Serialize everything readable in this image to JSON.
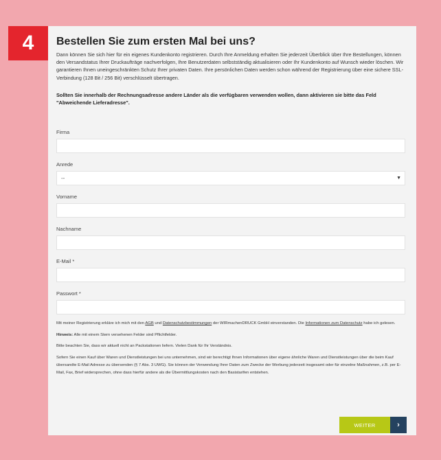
{
  "step": {
    "number": "4"
  },
  "header": {
    "title": "Bestellen Sie zum ersten Mal bei uns?",
    "intro": "Dann können Sie sich hier für ein eigenes Kundenkonto registrieren. Durch Ihre Anmeldung erhalten Sie jederzeit Überblick über Ihre Bestellungen, können den Versandstatus Ihrer Druckaufträge nachverfolgen, Ihre Benutzerdaten selbstständig aktualisieren oder Ihr Kundenkonto auf Wunsch wieder löschen. Wir garantieren Ihnen uneingeschränkten Schutz Ihrer privaten Daten. Ihre persönlichen Daten werden schon während der Registrierung über eine sichere SSL-Verbindung (128 Bit / 256 Bit) verschlüsselt übertragen.",
    "notice": "Sollten Sie innerhalb der Rechnungsadresse andere Länder als die verfügbaren verwenden wollen, dann aktivieren sie bitte das Feld \"Abweichende Lieferadresse\"."
  },
  "form": {
    "firma": {
      "label": "Firma",
      "value": ""
    },
    "anrede": {
      "label": "Anrede",
      "selected": "--"
    },
    "vorname": {
      "label": "Vorname",
      "value": ""
    },
    "nachname": {
      "label": "Nachname",
      "value": ""
    },
    "email": {
      "label": "E-Mail *",
      "value": ""
    },
    "passwort": {
      "label": "Passwort *",
      "value": ""
    }
  },
  "legal": {
    "consent_prefix": "Mit meiner Registrierung erkläre ich mich mit den ",
    "agb_link": "AGB",
    "consent_and": " und ",
    "privacy_link": "Datenschutzbestimmungen",
    "consent_mid": " der WIRmachenDRUCK GmbH einverstanden. Die ",
    "info_link": "Informationen zum Datenschutz",
    "consent_suffix": " habe ich gelesen.",
    "hint_label": "Hinweis:",
    "hint_text": " Alle mit einem Stern versehenen Felder sind Pflichtfelder.",
    "packstation": "Bitte beachten Sie, dass wir aktuell nicht an Packstationen liefern. Vielen Dank für Ihr Verständnis.",
    "marketing": "Sofern Sie einen Kauf über Waren und Dienstleistungen bei uns unternehmen, sind wir berechtigt Ihnen Informationen über eigene ähnliche Waren und Dienstleistungen über die beim Kauf übersandte E-Mail Adresse zu übersenden (§ 7 Abs. 3 UWG). Sie können der Verwendung Ihrer Daten zum Zwecke der Werbung jederzeit insgesamt oder für einzelne Maßnahmen, z.B. per E-Mail, Fax, Brief widersprechen, ohne dass hierfür andere als die Übermittlungskosten nach den Basistarifen entstehen."
  },
  "actions": {
    "submit_label": "WEITER",
    "arrow_glyph": "›"
  },
  "colors": {
    "background": "#f2a7ae",
    "badge": "#e4252d",
    "button": "#b7c816",
    "arrow_button": "#24425f"
  }
}
